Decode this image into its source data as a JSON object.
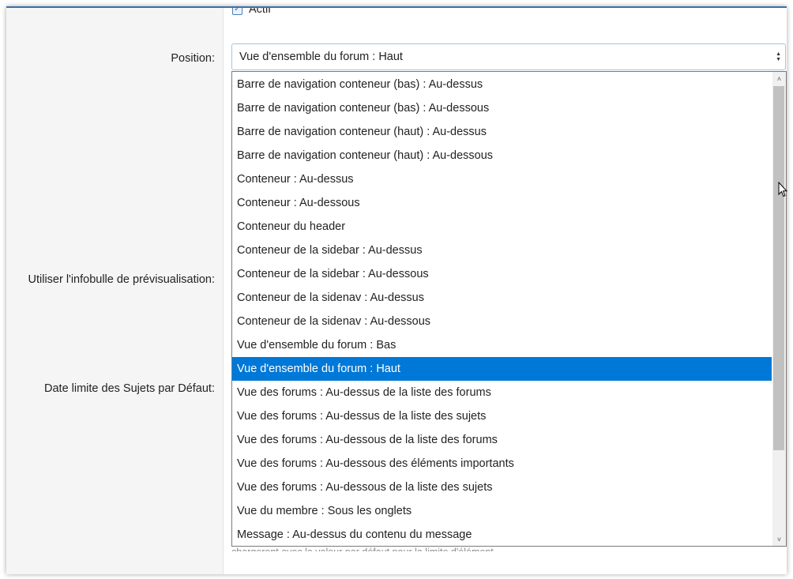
{
  "active_checkbox": {
    "label": "Actif",
    "checked": true
  },
  "labels": {
    "position": "Position:",
    "preview_tooltip": "Utiliser l'infobulle de prévisualisation:",
    "date_limit": "Date limite des Sujets par Défaut:"
  },
  "position_select": {
    "value": "Vue d'ensemble du forum : Haut",
    "options": [
      "Barre de navigation conteneur (bas) : Au-dessus",
      "Barre de navigation conteneur (bas) : Au-dessous",
      "Barre de navigation conteneur (haut) : Au-dessus",
      "Barre de navigation conteneur (haut) : Au-dessous",
      "Conteneur : Au-dessus",
      "Conteneur : Au-dessous",
      "Conteneur du header",
      "Conteneur de la sidebar : Au-dessus",
      "Conteneur de la sidebar : Au-dessous",
      "Conteneur de la sidenav : Au-dessus",
      "Conteneur de la sidenav : Au-dessous",
      "Vue d'ensemble du forum : Bas",
      "Vue d'ensemble du forum : Haut",
      "Vue des forums : Au-dessus de la liste des forums",
      "Vue des forums : Au-dessus de la liste des sujets",
      "Vue des forums : Au-dessous de la liste des forums",
      "Vue des forums : Au-dessous des éléments importants",
      "Vue des forums : Au-dessous de la liste des sujets",
      "Vue du membre : Sous les onglets",
      "Message : Au-dessus du contenu du message"
    ],
    "selected_index": 12
  },
  "hint_text": "chargeront avec la valeur par défaut pour la limite d'élément.",
  "colors": {
    "selected": "#0078d7",
    "accent_border": "#3f6fa8"
  }
}
